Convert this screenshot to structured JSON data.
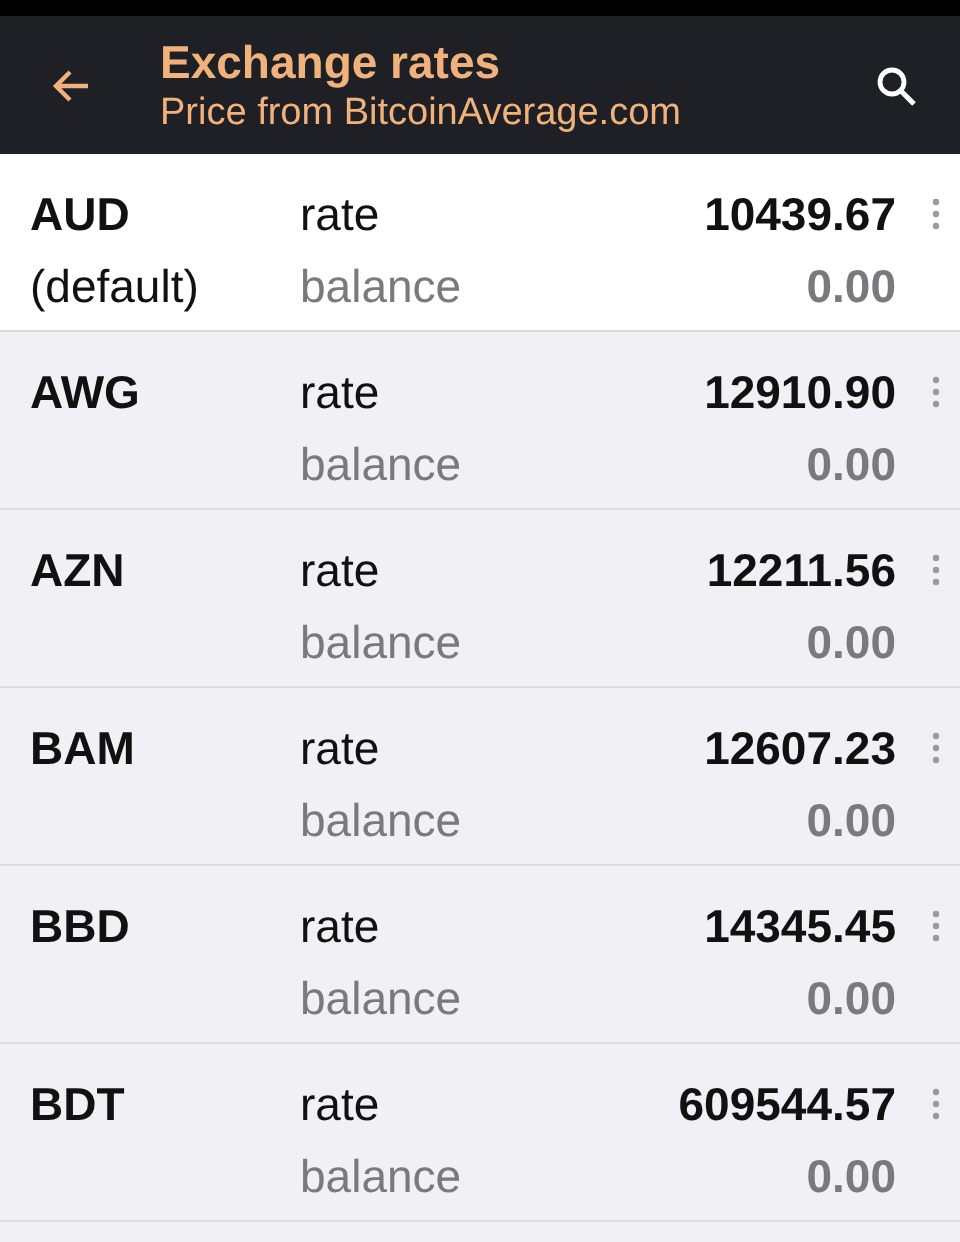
{
  "header": {
    "title": "Exchange rates",
    "subtitle": "Price from BitcoinAverage.com"
  },
  "rates": [
    {
      "code": "AUD",
      "note": "(default)",
      "selected": true,
      "rate_label": "rate",
      "rate": "10439.67",
      "balance_label": "balance",
      "balance": "0.00"
    },
    {
      "code": "AWG",
      "selected": false,
      "rate_label": "rate",
      "rate": "12910.90",
      "balance_label": "balance",
      "balance": "0.00"
    },
    {
      "code": "AZN",
      "selected": false,
      "rate_label": "rate",
      "rate": "12211.56",
      "balance_label": "balance",
      "balance": "0.00"
    },
    {
      "code": "BAM",
      "selected": false,
      "rate_label": "rate",
      "rate": "12607.23",
      "balance_label": "balance",
      "balance": "0.00"
    },
    {
      "code": "BBD",
      "selected": false,
      "rate_label": "rate",
      "rate": "14345.45",
      "balance_label": "balance",
      "balance": "0.00"
    },
    {
      "code": "BDT",
      "selected": false,
      "rate_label": "rate",
      "rate": "609544.57",
      "balance_label": "balance",
      "balance": "0.00"
    }
  ]
}
